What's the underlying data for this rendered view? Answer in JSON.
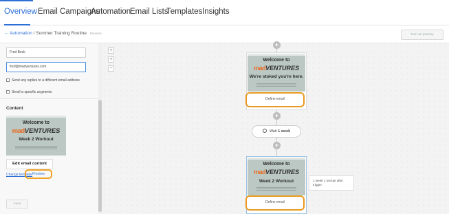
{
  "nav": {
    "tabs": [
      {
        "label": "Overview",
        "active": true
      },
      {
        "label": "Email Campaigns"
      },
      {
        "label": "Automation"
      },
      {
        "label": "Email Lists"
      },
      {
        "label": "Templates"
      },
      {
        "label": "Insights"
      }
    ],
    "accent_color": "#2c6fd6"
  },
  "breadcrumb": {
    "back_label": "← Automation",
    "separator": "/",
    "current": "Summer Training Routine",
    "rename_label": "Rename"
  },
  "header": {
    "turn_on_label": "Turn on journey"
  },
  "sidebar": {
    "from_name": "Fred Beck",
    "from_email": "fred@madventures.com",
    "option_replies": "Send any replies to a different email address",
    "option_segments": "Send to specific segments",
    "content_heading": "Content",
    "edit_button": "Edit email content",
    "change_template": "Change template",
    "preview": "Preview",
    "save": "Save"
  },
  "email_preview": {
    "welcome": "Welcome to",
    "logo_mad": "mad",
    "logo_ventures": "VENTURES",
    "sidebar_subtitle": "Week 2 Workout",
    "highlight_color": "#ea9a20"
  },
  "flow": {
    "step1_subtitle": "We're stoked you're here.",
    "step1_define": "Define email",
    "wait_label": "Wait",
    "wait_value": "1 week",
    "step2_subtitle": "Week 2 Workout",
    "step2_define": "Define email",
    "tooltip": "1 week 1 minute after trigger"
  },
  "zoom": {
    "in": "+",
    "out": "−",
    "fit": "+"
  }
}
